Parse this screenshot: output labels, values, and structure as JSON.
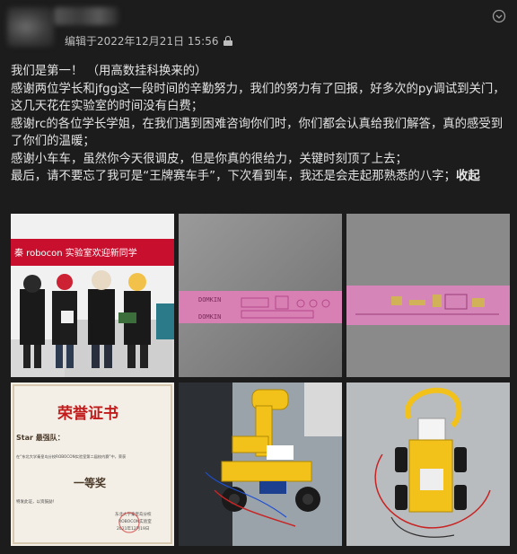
{
  "post": {
    "meta_text": "编辑于2022年12月21日 15:56",
    "privacy_icon": "lock-icon",
    "more_icon": "more-horizontal-icon",
    "paragraphs": [
      "我们是第一！ （用高数挂科换来的）",
      "感谢两位学长和jfgg这一段时间的辛勤努力，我们的努力有了回报，好多次的py调试到关门，这几天花在实验室的时间没有白费；",
      "感谢rc的各位学长学姐，在我们遇到困难咨询你们时，你们都会认真给我们解答，真的感受到了你们的温暖；",
      "感谢小车车，虽然你今天很调皮，但是你真的很给力，关键时刻顶了上去；",
      "最后，请不要忘了我可是“王牌赛车手”，下次看到车，我还是会走起那熟悉的八字；"
    ],
    "collapse_label": "收起",
    "photos": {
      "photo1_banner": "秦 robocon 实验室欢迎新同学",
      "photo2_text_a": "DOMKIN",
      "photo2_text_b": "DOMKIN",
      "photo4_title": "荣誉证书",
      "photo4_team": "Star 最强队：",
      "photo4_body": "在“东北大学秦皇岛分校ROBOCON实验室第二届校内赛”中，荣获",
      "photo4_award": "一等奖",
      "photo4_note": "特发此证，以资鼓励！",
      "photo4_org1": "东北大学秦皇岛分校",
      "photo4_org2": "ROBOCON实验室",
      "photo4_date": "2021年12月19日"
    }
  }
}
